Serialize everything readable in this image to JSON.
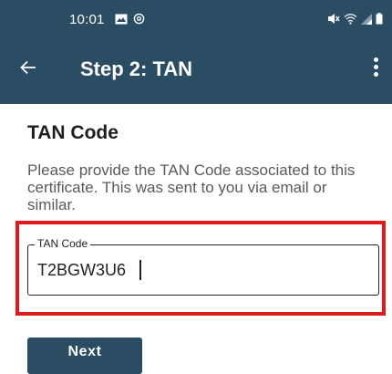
{
  "status_bar": {
    "time": "10:01",
    "left_icons": [
      "image-icon",
      "at-icon"
    ],
    "right_icons": [
      "mute-icon",
      "wifi-icon",
      "signal-icon",
      "battery-icon"
    ]
  },
  "toolbar": {
    "back_icon": "back-arrow-icon",
    "title": "Step 2: TAN",
    "menu_icon": "more-vert-icon"
  },
  "content": {
    "section_title": "TAN Code",
    "description": "Please provide the TAN Code associated to this certificate. This was sent to you via email or similar.",
    "tan_field": {
      "label": "TAN Code",
      "value": "T2BGW3U6"
    },
    "next_button_label": "Next"
  },
  "colors": {
    "primary": "#2a4d63",
    "highlight": "#e0191d"
  }
}
